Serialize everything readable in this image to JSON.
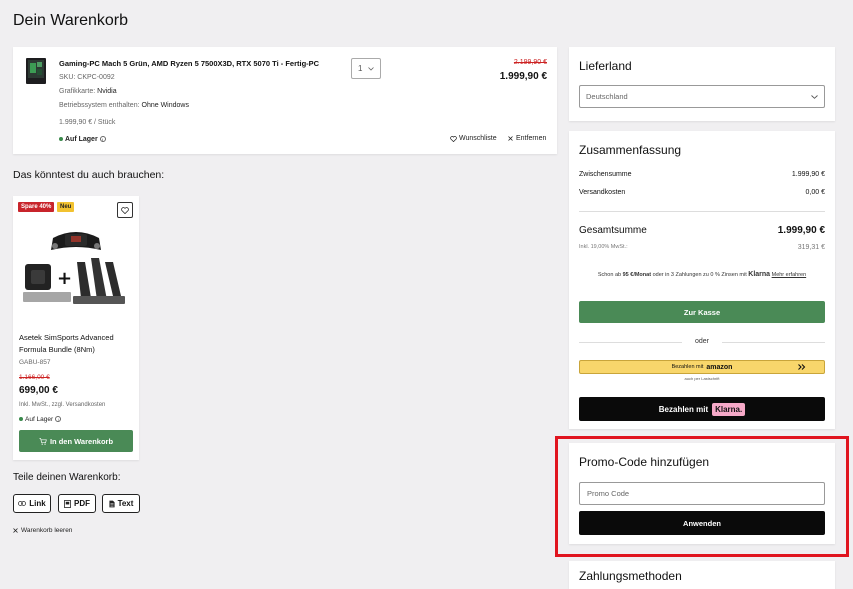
{
  "page": {
    "title": "Dein Warenkorb"
  },
  "cart_item": {
    "name": "Gaming-PC Mach 5 Grün, AMD Ryzen 5 7500X3D, RTX 5070 Ti - Fertig-PC",
    "sku": "SKU: CKPC-0092",
    "gpu_label": "Grafikkarte:",
    "gpu_value": "Nvidia",
    "os_label": "Betriebssystem enthalten:",
    "os_value": "Ohne Windows",
    "unit_price": "1.999,90 € / Stück",
    "stock": "Auf Lager",
    "quantity": "1",
    "old_price": "2.199,90 €",
    "price": "1.999,90 €",
    "wishlist_label": "Wunschliste",
    "remove_label": "Entfernen"
  },
  "recommend": {
    "title": "Das könntest du auch brauchen:",
    "badge_sale": "Spare 40%",
    "badge_new": "Neu",
    "name": "Asetek SimSports Advanced Formula Bundle (8Nm)",
    "sku": "GABU-857",
    "old_price": "1.166,00 €",
    "price": "699,00 €",
    "tax_note": "Inkl. MwSt., zzgl. Versandkosten",
    "stock": "Auf Lager",
    "add_label": "In den Warenkorb"
  },
  "share": {
    "title": "Teile deinen Warenkorb:",
    "link_label": "Link",
    "pdf_label": "PDF",
    "text_label": "Text",
    "clear_label": "Warenkorb leeren"
  },
  "delivery": {
    "title": "Lieferland",
    "country": "Deutschland"
  },
  "summary": {
    "title": "Zusammenfassung",
    "subtotal_label": "Zwischensumme",
    "subtotal_value": "1.999,90 €",
    "shipping_label": "Versandkosten",
    "shipping_value": "0,00 €",
    "total_label": "Gesamtsumme",
    "total_value": "1.999,90 €",
    "tax_label": "Inkl. 19,00% MwSt.:",
    "tax_value": "319,31 €",
    "klarna_pre": "Schon ab ",
    "klarna_amount": "95 €/Monat",
    "klarna_post": " oder in 3 Zahlungen zu 0 % Zinsen mit ",
    "klarna_brand": "Klarna",
    "klarna_link": "Mehr erfahren",
    "checkout_label": "Zur Kasse",
    "or_label": "oder",
    "amazon_pre": "Bezahlen mit",
    "amazon_brand": "amazon",
    "amazon_sub": "auch per Lastschrift",
    "klarna_pay_pre": "Bezahlen mit",
    "klarna_pay_brand": "Klarna."
  },
  "promo": {
    "title": "Promo-Code hinzufügen",
    "placeholder": "Promo Code",
    "apply_label": "Anwenden"
  },
  "payment": {
    "title": "Zahlungsmethoden"
  },
  "colors": {
    "accent_green": "#4a8a56",
    "sale_red": "#c8242b",
    "new_yellow": "#f2c230",
    "highlight_red": "#e0141f",
    "klarna_pink": "#f6a9c8",
    "amazon_yellow": "#f8d66b"
  }
}
